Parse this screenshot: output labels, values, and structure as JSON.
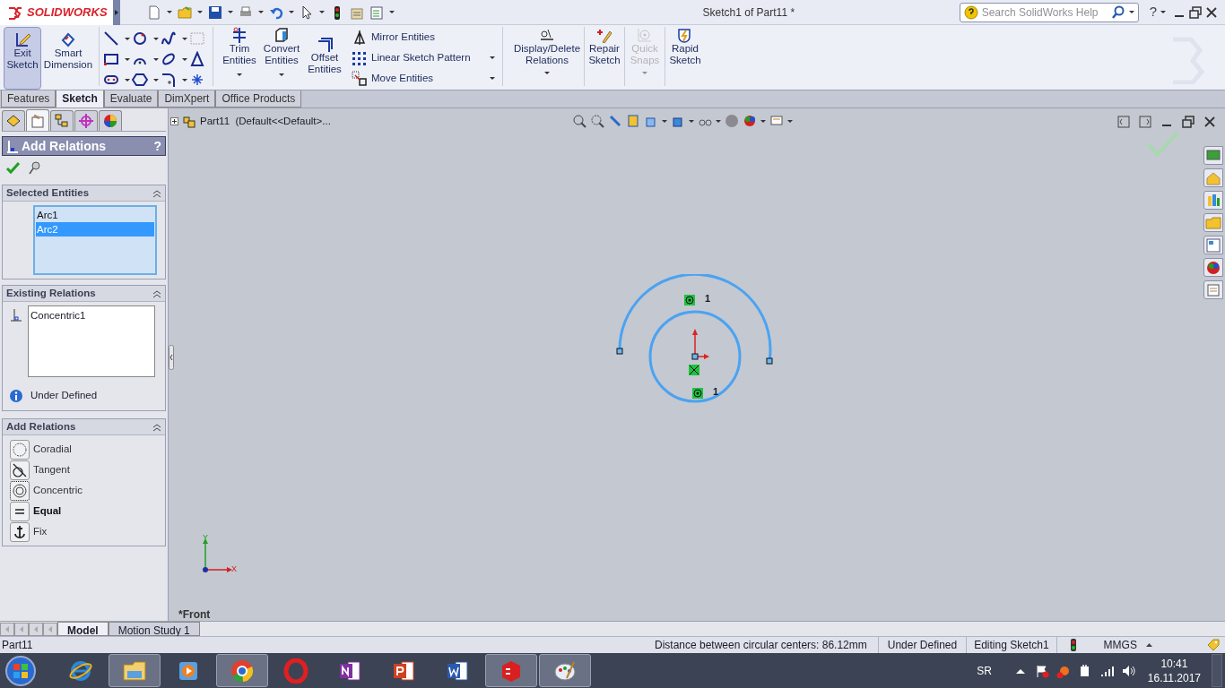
{
  "app": {
    "logo": "SOLIDWORKS"
  },
  "window": {
    "title": "Sketch1 of Part11 *"
  },
  "search": {
    "placeholder": "Search SolidWorks Help"
  },
  "help_button": "?",
  "ribbon": {
    "main": [
      {
        "label": "Exit Sketch",
        "selected": true
      },
      {
        "label": "Smart Dimension",
        "selected": false
      }
    ],
    "entities": [
      {
        "label": "Trim Entities"
      },
      {
        "label": "Convert Entities"
      },
      {
        "label": "Offset Entities"
      }
    ],
    "list": [
      {
        "label": "Mirror Entities"
      },
      {
        "label": "Linear Sketch Pattern"
      },
      {
        "label": "Move Entities"
      }
    ],
    "tools": [
      {
        "label": "Display/Delete Relations",
        "disabled": false
      },
      {
        "label": "Repair Sketch",
        "disabled": false
      },
      {
        "label": "Quick Snaps",
        "disabled": true
      },
      {
        "label": "Rapid Sketch",
        "disabled": false
      }
    ]
  },
  "tabs": [
    {
      "label": "Features",
      "selected": false
    },
    {
      "label": "Sketch",
      "selected": true
    },
    {
      "label": "Evaluate",
      "selected": false
    },
    {
      "label": "DimXpert",
      "selected": false
    },
    {
      "label": "Office Products",
      "selected": false
    }
  ],
  "panel": {
    "tabs": [
      {
        "selected": false
      },
      {
        "selected": true
      },
      {
        "selected": false
      },
      {
        "selected": false
      },
      {
        "selected": false
      }
    ],
    "title": "Add Relations",
    "help": "?",
    "selected_entities": {
      "title": "Selected Entities",
      "items": [
        {
          "label": "Arc1",
          "selected": false
        },
        {
          "label": "Arc2",
          "selected": true
        }
      ]
    },
    "existing_relations": {
      "title": "Existing Relations",
      "items": [
        "Concentric1"
      ],
      "status": "Under Defined"
    },
    "add_relations": {
      "title": "Add Relations",
      "options": [
        {
          "label": "Coradial",
          "kind": "coradial",
          "focused": false,
          "recommended": false
        },
        {
          "label": "Tangent",
          "kind": "tangent",
          "focused": false,
          "recommended": false
        },
        {
          "label": "Concentric",
          "kind": "concentric",
          "focused": true,
          "recommended": false
        },
        {
          "label": "Equal",
          "kind": "equal",
          "focused": false,
          "recommended": true
        },
        {
          "label": "Fix",
          "kind": "fix",
          "focused": false,
          "recommended": false
        }
      ]
    }
  },
  "feature_tree": {
    "root": "Part11  (Default<<Default>..."
  },
  "canvas": {
    "relation_marks": [
      "1",
      "1"
    ],
    "axis_labels": [
      "Y",
      "X"
    ],
    "view_name": "*Front"
  },
  "bottom_tabs": [
    {
      "label": "Model",
      "selected": true
    },
    {
      "label": "Motion Study 1",
      "selected": false
    }
  ],
  "status_bar": {
    "document": "Part11",
    "message": "Distance between circular centers: 86.12mm",
    "state": "Under Defined",
    "mode": "Editing Sketch1",
    "units": "MMGS"
  },
  "taskbar": {
    "apps": [
      {
        "kind": "ie",
        "running": false
      },
      {
        "kind": "explorer",
        "running": true
      },
      {
        "kind": "media",
        "running": false
      },
      {
        "kind": "chrome",
        "running": true
      },
      {
        "kind": "opera",
        "running": false
      },
      {
        "kind": "onenote",
        "running": false
      },
      {
        "kind": "powerpoint",
        "running": false
      },
      {
        "kind": "word",
        "running": false
      },
      {
        "kind": "solidworks",
        "running": true
      },
      {
        "kind": "paint",
        "running": true
      }
    ],
    "language": "SR",
    "time": "10:41",
    "date": "16.11.2017"
  }
}
